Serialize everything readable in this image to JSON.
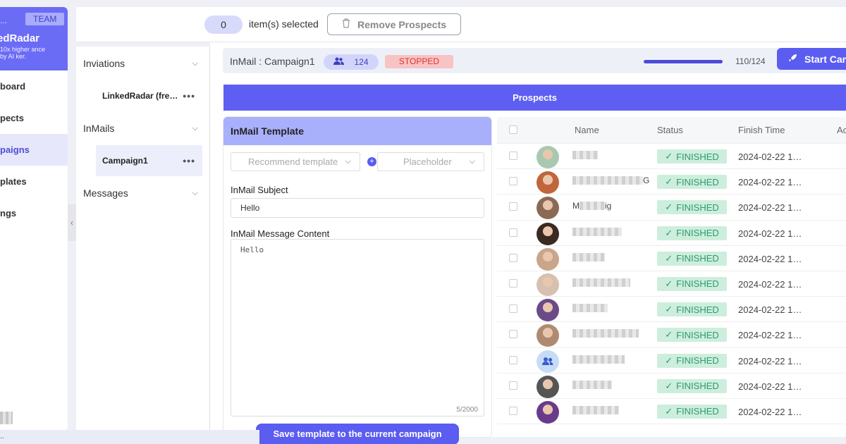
{
  "sidebar": {
    "workspace": "...",
    "team_badge": "TEAM",
    "brand_name": "edRadar",
    "tagline": "10x higher ance by AI ker.",
    "items": [
      {
        "label": "board",
        "active": false
      },
      {
        "label": "pects",
        "active": false
      },
      {
        "label": "paigns",
        "active": true
      },
      {
        "label": "plates",
        "active": false
      },
      {
        "label": "ngs",
        "active": false
      }
    ]
  },
  "topbar": {
    "selected_count": "0",
    "selected_text": "item(s) selected",
    "remove_label": "Remove Prospects"
  },
  "panel": {
    "groups": [
      {
        "label": "Inviations",
        "children": [
          {
            "label": "LinkedRadar (fre…",
            "active": false
          }
        ]
      },
      {
        "label": "InMails",
        "children": [
          {
            "label": "Campaign1",
            "active": true
          }
        ]
      },
      {
        "label": "Messages",
        "children": []
      }
    ]
  },
  "campaign": {
    "title": "InMail : Campaign1",
    "prospect_count": "124",
    "status": "STOPPED",
    "progress_fraction": 0.887,
    "progress_text": "110/124",
    "start_label": "Start Campaign"
  },
  "prospects_header": "Prospects",
  "template": {
    "header": "InMail Template",
    "recommend_placeholder": "Recommend template",
    "placeholder_label": "Placeholder",
    "subject_label": "InMail Subject",
    "subject_value": "Hello",
    "content_label": "InMail Message Content",
    "content_value": "Hello",
    "char_count": "5/2000",
    "save_label": "Save template to the current campaign"
  },
  "table": {
    "columns": [
      "Name",
      "Status",
      "Finish Time",
      "Ac"
    ],
    "rows": [
      {
        "name_prefix": "",
        "name_suffix": "",
        "status": "FINISHED",
        "finish_time": "2024-02-22 1…",
        "avatar_color": "#a8c9b0"
      },
      {
        "name_prefix": "",
        "name_suffix": "G",
        "status": "FINISHED",
        "finish_time": "2024-02-22 1…",
        "avatar_color": "#c0663a"
      },
      {
        "name_prefix": "M",
        "name_suffix": "ig",
        "status": "FINISHED",
        "finish_time": "2024-02-22 1…",
        "avatar_color": "#8a6a55"
      },
      {
        "name_prefix": "",
        "name_suffix": "",
        "status": "FINISHED",
        "finish_time": "2024-02-22 1…",
        "avatar_color": "#3a2a22"
      },
      {
        "name_prefix": "",
        "name_suffix": "",
        "status": "FINISHED",
        "finish_time": "2024-02-22 1…",
        "avatar_color": "#c9a58a"
      },
      {
        "name_prefix": "",
        "name_suffix": "",
        "status": "FINISHED",
        "finish_time": "2024-02-22 1…",
        "avatar_color": "#d7c0b0"
      },
      {
        "name_prefix": "",
        "name_suffix": "",
        "status": "FINISHED",
        "finish_time": "2024-02-22 1…",
        "avatar_color": "#6b4a8a"
      },
      {
        "name_prefix": "",
        "name_suffix": "",
        "status": "FINISHED",
        "finish_time": "2024-02-22 1…",
        "avatar_color": "#b08a70"
      },
      {
        "name_prefix": "",
        "name_suffix": "",
        "status": "FINISHED",
        "finish_time": "2024-02-22 1…",
        "avatar_color": "#c6dcf6",
        "placeholder": true
      },
      {
        "name_prefix": "",
        "name_suffix": "",
        "status": "FINISHED",
        "finish_time": "2024-02-22 1…",
        "avatar_color": "#555555"
      },
      {
        "name_prefix": "",
        "name_suffix": "",
        "status": "FINISHED",
        "finish_time": "2024-02-22 1…",
        "avatar_color": "#6a3a8a"
      }
    ]
  },
  "bottom_strip_text": "..",
  "colors": {
    "accent": "#5b5cf0",
    "brand": "#6b6cf6",
    "finished_bg": "#cdeedd",
    "finished_text": "#2f9a6e",
    "stopped_bg": "#f8c3c3",
    "stopped_text": "#dd3333"
  }
}
